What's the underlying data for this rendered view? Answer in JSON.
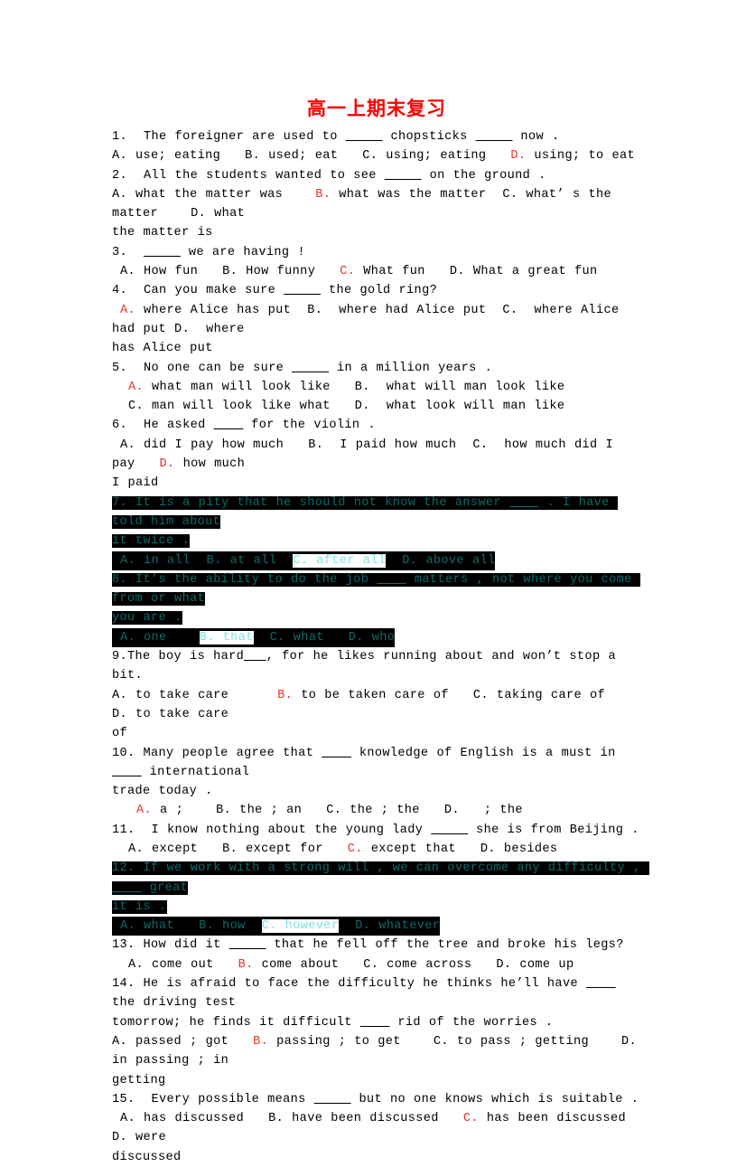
{
  "document": {
    "title": "高一上期末复习",
    "title_color": "#ff0000",
    "highlight_bg": "#000000",
    "highlight_fg": "#0d6a6a",
    "highlight_pick_bg": "#ffffff",
    "highlight_pick_fg": "#7fe3e3",
    "answer_color": "#e8342b"
  },
  "questions": [
    {
      "number": "1.",
      "stem": "1.  The foreigner are used to _____ chopsticks _____ now .",
      "options_line": "A. use; eating   B. used; eat   C. using; eating   D. using; to eat",
      "answer": "D"
    },
    {
      "number": "2.",
      "stem": "2.  All the students wanted to see _____ on the ground .",
      "options_line": "A. what the matter was   B. what was the matter  C. what's the matter   D. what the matter is",
      "answer": "B"
    },
    {
      "number": "3.",
      "stem": "3.  _____ we are having !",
      "options_line": " A. How fun   B. How funny   C. What fun   D. What a great fun",
      "answer": "C"
    },
    {
      "number": "4.",
      "stem": "4.  Can you make sure _____ the gold ring?",
      "options_line": " A. where Alice has put  B. where had Alice put  C. where Alice had put D. where has Alice put",
      "answer": "A"
    },
    {
      "number": "5.",
      "stem": "5.  No one can be sure _____ in a million years .",
      "options_line_1": "  A. what man will look like   B. what will man look like",
      "options_line_2": "  C. man will look like what   D. what look will man like",
      "answer": "A"
    },
    {
      "number": "6.",
      "stem": "6.  He asked ____ for the violin .",
      "options_line": " A. did I pay how much   B. I paid how much  C. how much did I pay   D. how much I paid",
      "answer": "D"
    },
    {
      "number": "7.",
      "stem_1": "7. It is a pity that he should not know the answer ____ . I have told him about",
      "stem_2": "it twice .",
      "opt_a": " A. in all  B. at all  ",
      "opt_pick": "C. after all",
      "opt_d": "  D. above all",
      "answer": "C",
      "highlighted": true
    },
    {
      "number": "8.",
      "stem_1": "8. It's the ability to do the job ____ matters , not where you come from or what",
      "stem_2": "you are .",
      "opt_a": " A. one    ",
      "opt_pick": "B. that",
      "opt_d": "  C. what   D. who",
      "answer": "B",
      "highlighted": true
    },
    {
      "number": "9.",
      "stem": "9.The boy is hard___, for he likes running about and won't stop a bit.",
      "options_line": "A. to take care       B. to be taken care of   C. taking care of      D. to take care of",
      "answer": "B"
    },
    {
      "number": "10.",
      "stem": "10. Many people agree that ____ knowledge of English is a must in ____ international trade today .",
      "options_line": "   A. a ;    B. the ; an   C. the ; the   D.   ; the",
      "answer": "A"
    },
    {
      "number": "11.",
      "stem": "11. I know nothing about the young lady _____ she is from Beijing .",
      "options_line": "  A. except   B. except for   C. except that   D. besides",
      "answer": "C"
    },
    {
      "number": "12.",
      "stem_1": "12. If we work with a strong will , we can overcome any difficulty , ____ great",
      "stem_2": "it is .",
      "opt_a": " A. what   B. how  ",
      "opt_pick": "C. however",
      "opt_d": "  D. whatever",
      "answer": "C",
      "highlighted": true
    },
    {
      "number": "13.",
      "stem": "13. How did it _____ that he fell off the tree and broke his legs?",
      "options_line": "  A. come out   B. come about   C. come across   D. come up",
      "answer": "B"
    },
    {
      "number": "14.",
      "stem": "14. He is afraid to face the difficulty he thinks he'll have ____ the driving test tomorrow; he finds it difficult ____ rid of the worries .",
      "options_line": "A. passed ; got   B. passing ; to get    C. to pass ; getting    D. in passing ; in getting",
      "answer": "B"
    },
    {
      "number": "15.",
      "stem": "15. Every possible means _____ but no one knows which is suitable .",
      "options_line": " A. has discussed   B. have been discussed   C. has been discussed   D. were discussed",
      "answer": "C"
    }
  ],
  "lines": {
    "q1_stem": "1.  The foreigner are used to ",
    "q1_stem_b": " chopsticks ",
    "q1_stem_c": " now ."
  }
}
